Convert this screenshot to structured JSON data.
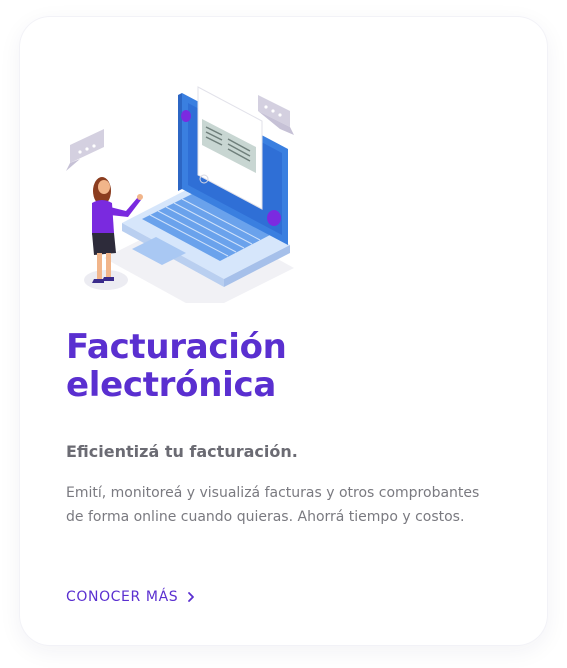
{
  "card": {
    "title_line1": "Facturación",
    "title_line2": "electrónica",
    "subtitle": "Eficientizá tu facturación.",
    "description_line1": "Emití, monitoreá y visualizá facturas y otros comprobantes",
    "description_line2": "de forma online cuando quieras. Ahorrá tiempo y costos.",
    "cta_label": "CONOCER MÁS",
    "cta_icon": "chevron-right-icon",
    "illustration_icon": "laptop-invoice-illustration"
  },
  "colors": {
    "accent": "#5a2fd0",
    "subtitle": "#6b6b73",
    "body_text": "#7a7a80",
    "laptop_blue": "#4a8fe8"
  }
}
